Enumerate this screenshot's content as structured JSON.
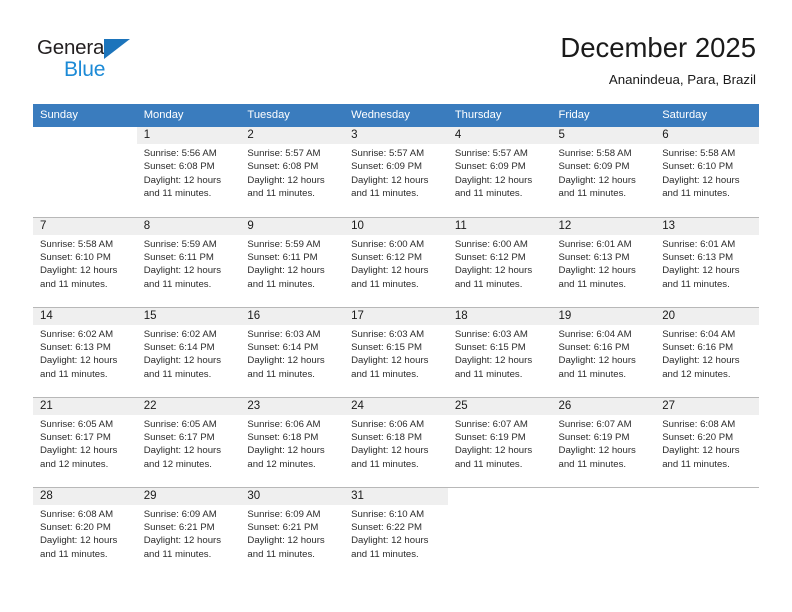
{
  "logo": {
    "word_dark": "General",
    "word_blue": "Blue",
    "triangle_color": "#1c74bb",
    "blue_color": "#1c8ad6"
  },
  "header": {
    "title": "December 2025",
    "location": "Ananindeua, Para, Brazil"
  },
  "theme": {
    "header_row_bg": "#3a7cbe",
    "daynum_band_bg": "#efefef",
    "grid_line": "#b8b8b8",
    "text": "#2b2b2b"
  },
  "weekday_headers": [
    "Sunday",
    "Monday",
    "Tuesday",
    "Wednesday",
    "Thursday",
    "Friday",
    "Saturday"
  ],
  "labels": {
    "sunrise_prefix": "Sunrise:",
    "sunset_prefix": "Sunset:",
    "daylight_prefix": "Daylight:"
  },
  "weeks": [
    [
      {
        "day": "",
        "blank": true
      },
      {
        "day": "1",
        "sunrise": "Sunrise: 5:56 AM",
        "sunset": "Sunset: 6:08 PM",
        "daylight": "Daylight: 12 hours and 11 minutes."
      },
      {
        "day": "2",
        "sunrise": "Sunrise: 5:57 AM",
        "sunset": "Sunset: 6:08 PM",
        "daylight": "Daylight: 12 hours and 11 minutes."
      },
      {
        "day": "3",
        "sunrise": "Sunrise: 5:57 AM",
        "sunset": "Sunset: 6:09 PM",
        "daylight": "Daylight: 12 hours and 11 minutes."
      },
      {
        "day": "4",
        "sunrise": "Sunrise: 5:57 AM",
        "sunset": "Sunset: 6:09 PM",
        "daylight": "Daylight: 12 hours and 11 minutes."
      },
      {
        "day": "5",
        "sunrise": "Sunrise: 5:58 AM",
        "sunset": "Sunset: 6:09 PM",
        "daylight": "Daylight: 12 hours and 11 minutes."
      },
      {
        "day": "6",
        "sunrise": "Sunrise: 5:58 AM",
        "sunset": "Sunset: 6:10 PM",
        "daylight": "Daylight: 12 hours and 11 minutes."
      }
    ],
    [
      {
        "day": "7",
        "sunrise": "Sunrise: 5:58 AM",
        "sunset": "Sunset: 6:10 PM",
        "daylight": "Daylight: 12 hours and 11 minutes."
      },
      {
        "day": "8",
        "sunrise": "Sunrise: 5:59 AM",
        "sunset": "Sunset: 6:11 PM",
        "daylight": "Daylight: 12 hours and 11 minutes."
      },
      {
        "day": "9",
        "sunrise": "Sunrise: 5:59 AM",
        "sunset": "Sunset: 6:11 PM",
        "daylight": "Daylight: 12 hours and 11 minutes."
      },
      {
        "day": "10",
        "sunrise": "Sunrise: 6:00 AM",
        "sunset": "Sunset: 6:12 PM",
        "daylight": "Daylight: 12 hours and 11 minutes."
      },
      {
        "day": "11",
        "sunrise": "Sunrise: 6:00 AM",
        "sunset": "Sunset: 6:12 PM",
        "daylight": "Daylight: 12 hours and 11 minutes."
      },
      {
        "day": "12",
        "sunrise": "Sunrise: 6:01 AM",
        "sunset": "Sunset: 6:13 PM",
        "daylight": "Daylight: 12 hours and 11 minutes."
      },
      {
        "day": "13",
        "sunrise": "Sunrise: 6:01 AM",
        "sunset": "Sunset: 6:13 PM",
        "daylight": "Daylight: 12 hours and 11 minutes."
      }
    ],
    [
      {
        "day": "14",
        "sunrise": "Sunrise: 6:02 AM",
        "sunset": "Sunset: 6:13 PM",
        "daylight": "Daylight: 12 hours and 11 minutes."
      },
      {
        "day": "15",
        "sunrise": "Sunrise: 6:02 AM",
        "sunset": "Sunset: 6:14 PM",
        "daylight": "Daylight: 12 hours and 11 minutes."
      },
      {
        "day": "16",
        "sunrise": "Sunrise: 6:03 AM",
        "sunset": "Sunset: 6:14 PM",
        "daylight": "Daylight: 12 hours and 11 minutes."
      },
      {
        "day": "17",
        "sunrise": "Sunrise: 6:03 AM",
        "sunset": "Sunset: 6:15 PM",
        "daylight": "Daylight: 12 hours and 11 minutes."
      },
      {
        "day": "18",
        "sunrise": "Sunrise: 6:03 AM",
        "sunset": "Sunset: 6:15 PM",
        "daylight": "Daylight: 12 hours and 11 minutes."
      },
      {
        "day": "19",
        "sunrise": "Sunrise: 6:04 AM",
        "sunset": "Sunset: 6:16 PM",
        "daylight": "Daylight: 12 hours and 11 minutes."
      },
      {
        "day": "20",
        "sunrise": "Sunrise: 6:04 AM",
        "sunset": "Sunset: 6:16 PM",
        "daylight": "Daylight: 12 hours and 12 minutes."
      }
    ],
    [
      {
        "day": "21",
        "sunrise": "Sunrise: 6:05 AM",
        "sunset": "Sunset: 6:17 PM",
        "daylight": "Daylight: 12 hours and 12 minutes."
      },
      {
        "day": "22",
        "sunrise": "Sunrise: 6:05 AM",
        "sunset": "Sunset: 6:17 PM",
        "daylight": "Daylight: 12 hours and 12 minutes."
      },
      {
        "day": "23",
        "sunrise": "Sunrise: 6:06 AM",
        "sunset": "Sunset: 6:18 PM",
        "daylight": "Daylight: 12 hours and 12 minutes."
      },
      {
        "day": "24",
        "sunrise": "Sunrise: 6:06 AM",
        "sunset": "Sunset: 6:18 PM",
        "daylight": "Daylight: 12 hours and 11 minutes."
      },
      {
        "day": "25",
        "sunrise": "Sunrise: 6:07 AM",
        "sunset": "Sunset: 6:19 PM",
        "daylight": "Daylight: 12 hours and 11 minutes."
      },
      {
        "day": "26",
        "sunrise": "Sunrise: 6:07 AM",
        "sunset": "Sunset: 6:19 PM",
        "daylight": "Daylight: 12 hours and 11 minutes."
      },
      {
        "day": "27",
        "sunrise": "Sunrise: 6:08 AM",
        "sunset": "Sunset: 6:20 PM",
        "daylight": "Daylight: 12 hours and 11 minutes."
      }
    ],
    [
      {
        "day": "28",
        "sunrise": "Sunrise: 6:08 AM",
        "sunset": "Sunset: 6:20 PM",
        "daylight": "Daylight: 12 hours and 11 minutes."
      },
      {
        "day": "29",
        "sunrise": "Sunrise: 6:09 AM",
        "sunset": "Sunset: 6:21 PM",
        "daylight": "Daylight: 12 hours and 11 minutes."
      },
      {
        "day": "30",
        "sunrise": "Sunrise: 6:09 AM",
        "sunset": "Sunset: 6:21 PM",
        "daylight": "Daylight: 12 hours and 11 minutes."
      },
      {
        "day": "31",
        "sunrise": "Sunrise: 6:10 AM",
        "sunset": "Sunset: 6:22 PM",
        "daylight": "Daylight: 12 hours and 11 minutes."
      },
      {
        "day": "",
        "blank": true
      },
      {
        "day": "",
        "blank": true
      },
      {
        "day": "",
        "blank": true
      }
    ]
  ]
}
